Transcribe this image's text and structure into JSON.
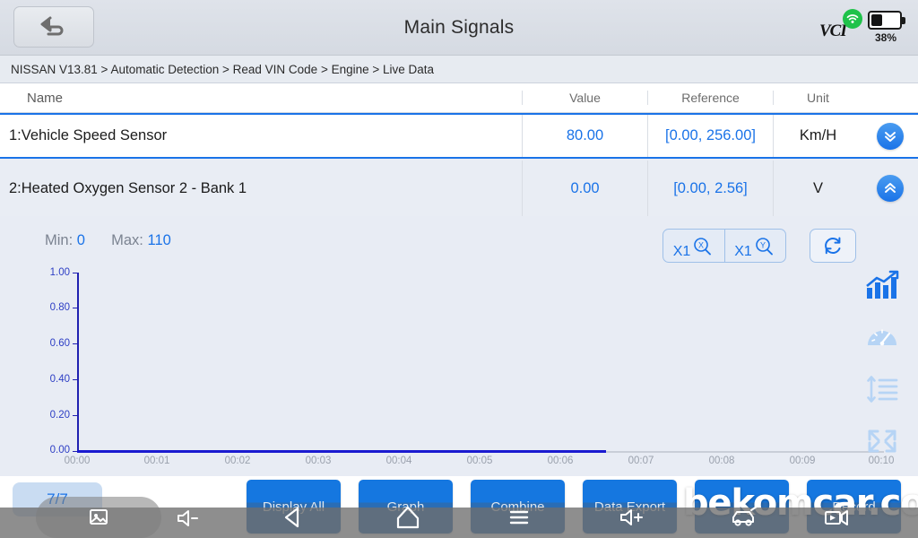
{
  "header": {
    "title": "Main Signals",
    "back_icon": "back-arrow-icon",
    "vci_label": "VCI",
    "battery_percent": "38%",
    "connection_icon": "wifi-signal-icon"
  },
  "breadcrumb": {
    "text": "NISSAN V13.81 > Automatic Detection  > Read VIN Code  > Engine > Live Data"
  },
  "table": {
    "columns": {
      "name": "Name",
      "value": "Value",
      "reference": "Reference",
      "unit": "Unit"
    },
    "rows": [
      {
        "name": "1:Vehicle Speed Sensor",
        "value": "80.00",
        "reference": "[0.00, 256.00]",
        "unit": "Km/H",
        "toggle_icon": "double-chevron-down-icon",
        "selected": "true"
      },
      {
        "name": "2:Heated Oxygen Sensor 2 - Bank 1",
        "value": "0.00",
        "reference": "[0.00, 2.56]",
        "unit": "V",
        "toggle_icon": "double-chevron-up-icon",
        "selected": "false"
      }
    ]
  },
  "graph_panel": {
    "min_label": "Min:",
    "min_value": "0",
    "max_label": "Max:",
    "max_value": "110",
    "zoom_x_factor": "X1",
    "zoom_y_factor": "X1",
    "zoom_x_icon": "magnifier-x-axis-icon",
    "zoom_y_icon": "magnifier-y-axis-icon",
    "reset_icon": "refresh-reset-icon",
    "side_icons": [
      {
        "name": "trend-chart-icon",
        "active": "true"
      },
      {
        "name": "gauge-dashboard-icon",
        "active": "false"
      },
      {
        "name": "row-height-list-icon",
        "active": "false"
      },
      {
        "name": "fullscreen-expand-icon",
        "active": "false"
      }
    ]
  },
  "chart_data": {
    "type": "line",
    "title": "",
    "xlabel": "",
    "ylabel": "",
    "ylim": [
      0.0,
      1.0
    ],
    "yticks": [
      "0.00",
      "0.20",
      "0.40",
      "0.60",
      "0.80",
      "1.00"
    ],
    "xticks": [
      "00:00",
      "00:01",
      "00:02",
      "00:03",
      "00:04",
      "00:05",
      "00:06",
      "00:07",
      "00:08",
      "00:09",
      "00:10"
    ],
    "grid": false,
    "legend": "none",
    "series": [
      {
        "name": "2:Heated Oxygen Sensor 2 - Bank 1",
        "color": "#1a1ad0",
        "x": [
          "00:00",
          "00:01",
          "00:02",
          "00:03",
          "00:04",
          "00:05",
          "00:06",
          "00:06.7"
        ],
        "values": [
          0.0,
          0.0,
          0.0,
          0.0,
          0.0,
          0.0,
          0.0,
          0.0
        ]
      }
    ]
  },
  "bottom": {
    "page_indicator": "7/7",
    "buttons": [
      {
        "label": "Display All"
      },
      {
        "label": "Graph"
      },
      {
        "label": "Combine"
      },
      {
        "label": "Data Export"
      },
      {
        "label": ""
      },
      {
        "label": "Record"
      }
    ]
  },
  "navbar": {
    "screenshot_icon": "screenshot-icon",
    "volume_down_icon": "volume-down-icon",
    "back_icon": "nav-back-triangle-icon",
    "home_icon": "nav-home-icon",
    "menu_icon": "nav-menu-lines-icon",
    "volume_up_icon": "volume-up-icon",
    "car_icon": "car-icon",
    "record_icon": "video-record-icon"
  },
  "watermark": {
    "text": "bekomcar.com"
  },
  "colors": {
    "accent": "#1a73e8",
    "panel_bg": "#e8ecf4",
    "line": "#1a1ad0",
    "battery_ok": "#1fc24a"
  }
}
